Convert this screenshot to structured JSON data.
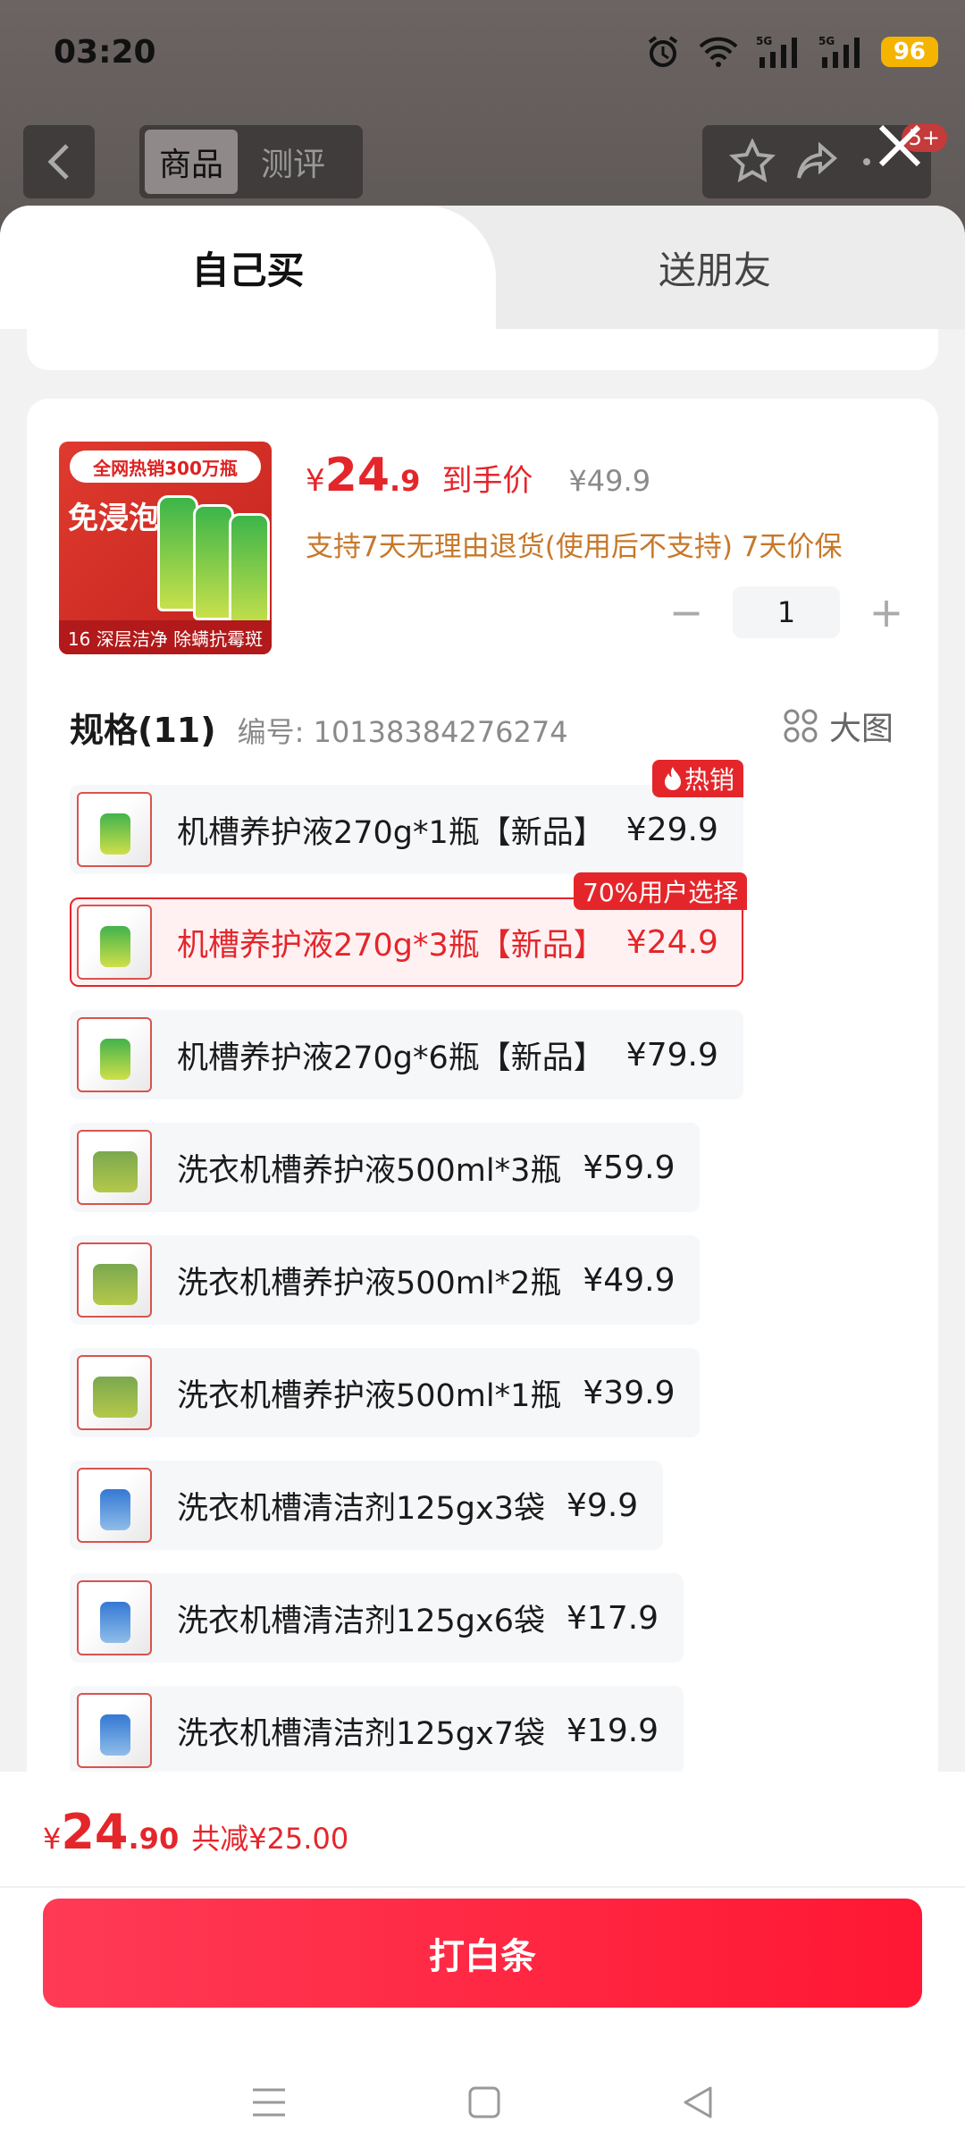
{
  "status_bar": {
    "time": "03:20",
    "battery": "96"
  },
  "background": {
    "tabs": [
      "商品",
      "测评"
    ],
    "badge": "5+"
  },
  "sheet": {
    "tabs": [
      "自己买",
      "送朋友"
    ],
    "product": {
      "price_symbol": "¥",
      "price_int": "24",
      "price_dec": ".9",
      "price_label": "到手价",
      "original_price": "¥49.9",
      "service_text": "支持7天无理由退货(使用后不支持) 7天价保",
      "thumb_banner": "全网热销300万瓶",
      "thumb_title": "免浸泡",
      "thumb_footer": "16 深层洁净 除螨抗霉斑",
      "quantity": "1"
    },
    "spec": {
      "title": "规格(11)",
      "number": "编号: 10138384276274",
      "big_pic_label": "大图",
      "options": [
        {
          "name": "机槽养护液270g*1瓶【新品】",
          "price": "¥29.9",
          "tag": "热销",
          "selected": false,
          "icon": "green-bottle"
        },
        {
          "name": "机槽养护液270g*3瓶【新品】",
          "price": "¥24.9",
          "tag": "70%用户选择",
          "selected": true,
          "icon": "green-bottle"
        },
        {
          "name": "机槽养护液270g*6瓶【新品】",
          "price": "¥79.9",
          "tag": "",
          "selected": false,
          "icon": "green-bottle"
        },
        {
          "name": "洗衣机槽养护液500ml*3瓶",
          "price": "¥59.9",
          "tag": "",
          "selected": false,
          "icon": "grey-bottle"
        },
        {
          "name": "洗衣机槽养护液500ml*2瓶",
          "price": "¥49.9",
          "tag": "",
          "selected": false,
          "icon": "grey-bottle"
        },
        {
          "name": "洗衣机槽养护液500ml*1瓶",
          "price": "¥39.9",
          "tag": "",
          "selected": false,
          "icon": "grey-bottle"
        },
        {
          "name": "洗衣机槽清洁剂125gx3袋",
          "price": "¥9.9",
          "tag": "",
          "selected": false,
          "icon": "blue-bag"
        },
        {
          "name": "洗衣机槽清洁剂125gx6袋",
          "price": "¥17.9",
          "tag": "",
          "selected": false,
          "icon": "blue-bag"
        },
        {
          "name": "洗衣机槽清洁剂125gx7袋",
          "price": "¥19.9",
          "tag": "",
          "selected": false,
          "icon": "blue-bag"
        }
      ]
    },
    "footer": {
      "total_symbol": "¥",
      "total_int": "24",
      "total_dec": ".90",
      "discount": "共减¥25.00",
      "pay_button": "打白条"
    }
  },
  "colors": {
    "accent": "#e4262b",
    "service": "#c7782a",
    "pay_start": "#ff3a55",
    "pay_end": "#ff1733"
  }
}
